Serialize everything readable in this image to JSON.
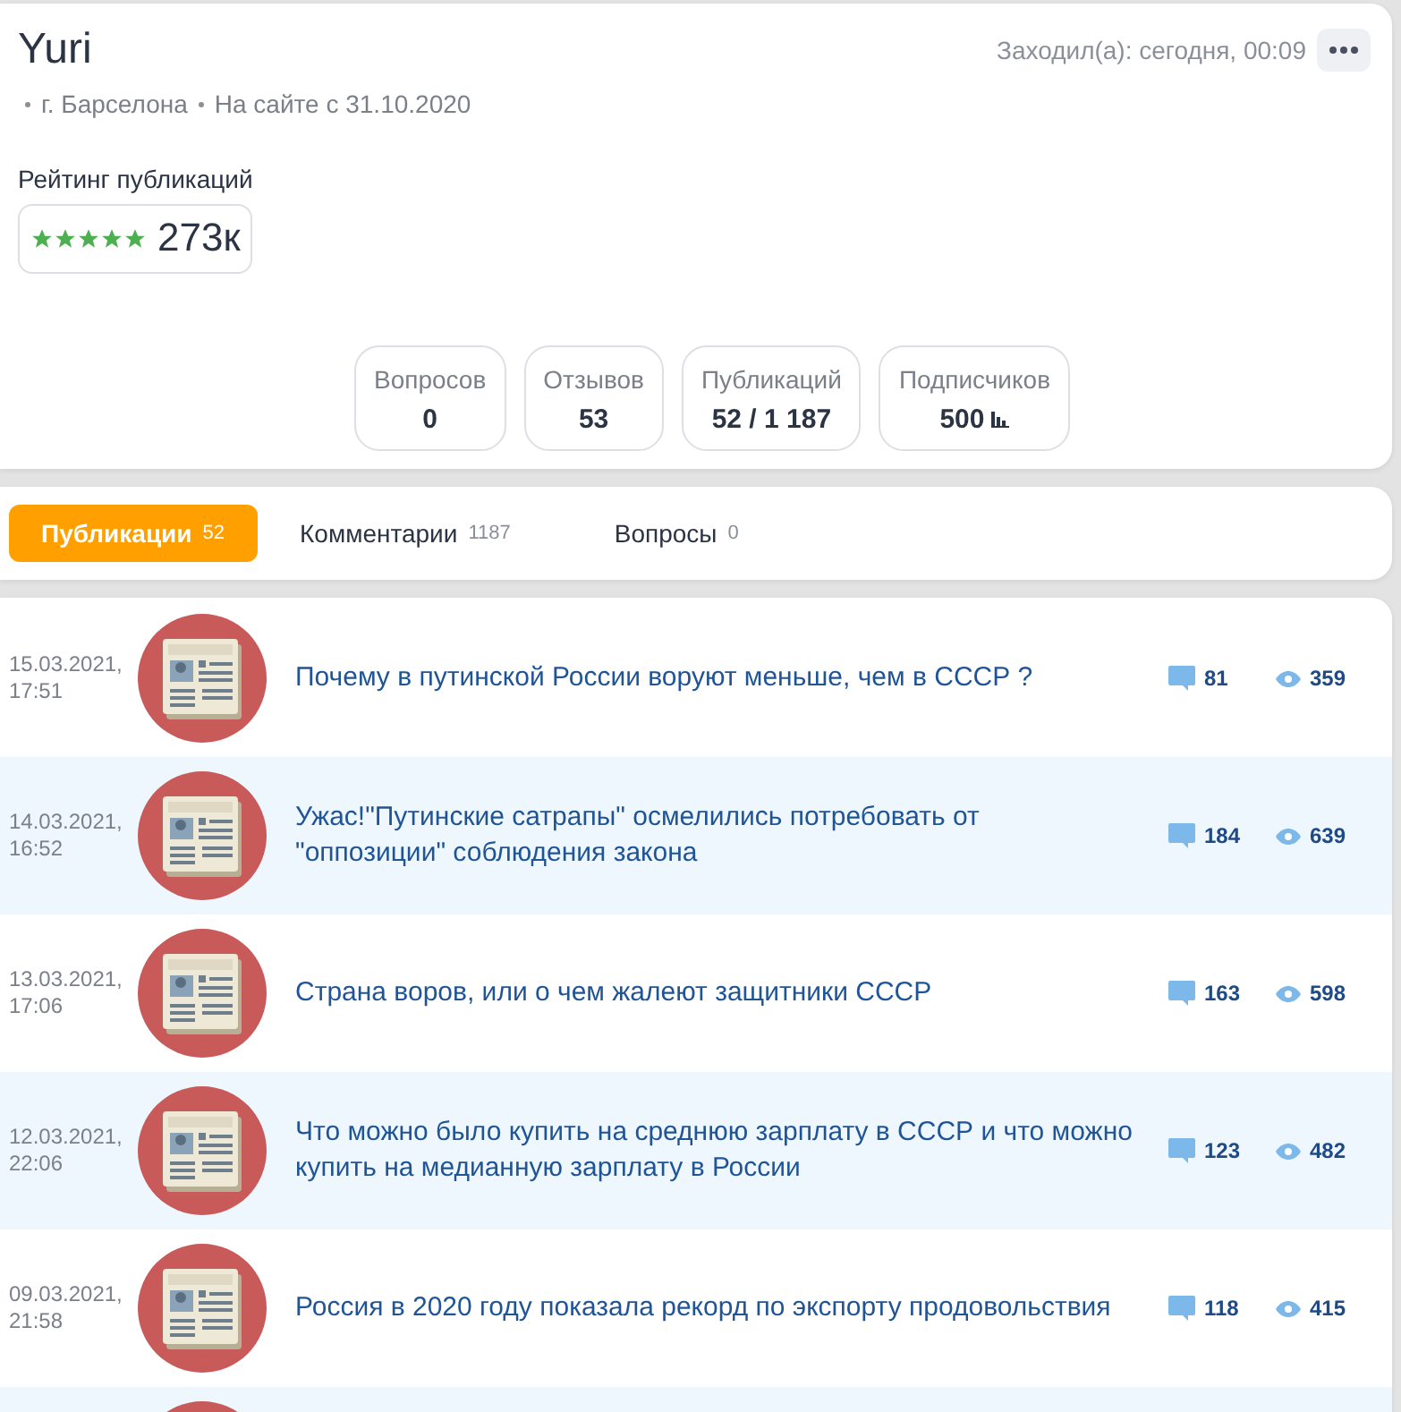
{
  "profile": {
    "name": "Yuri",
    "last_seen": "Заходил(а): сегодня, 00:09",
    "location": "г. Барселона",
    "member_since": "На сайте с 31.10.2020",
    "rating_label": "Рейтинг публикаций",
    "stars": 5,
    "rating_value": "273к",
    "stats": [
      {
        "label": "Вопросов",
        "value": "0",
        "chart_icon": false
      },
      {
        "label": "Отзывов",
        "value": "53",
        "chart_icon": false
      },
      {
        "label": "Публикаций",
        "value": "52 / 1 187",
        "chart_icon": false
      },
      {
        "label": "Подписчиков",
        "value": "500",
        "chart_icon": true
      }
    ]
  },
  "tabs": [
    {
      "label": "Публикации",
      "count": "52",
      "selected": true
    },
    {
      "label": "Комментарии",
      "count": "1187",
      "selected": false
    },
    {
      "label": "Вопросы",
      "count": "0",
      "selected": false
    }
  ],
  "posts": [
    {
      "kind": "full",
      "date": "15.03.2021,",
      "time": "17:51",
      "title": "Почему в путинской России воруют меньше, чем в СССР ?",
      "comments": "81",
      "views": "359"
    },
    {
      "kind": "full",
      "date": "14.03.2021,",
      "time": "16:52",
      "title": "Ужас!\"Путинские сатрапы\" осмелились потребовать от \"оппозиции\" соблюдения закона",
      "comments": "184",
      "views": "639"
    },
    {
      "kind": "full",
      "date": "13.03.2021,",
      "time": "17:06",
      "title": "Страна воров, или о чем жалеют защитники СССР",
      "comments": "163",
      "views": "598"
    },
    {
      "kind": "full",
      "date": "12.03.2021,",
      "time": "22:06",
      "title": "Что можно было купить на среднюю зарплату в СССР и что можно купить на медианную зарплату в России",
      "comments": "123",
      "views": "482"
    },
    {
      "kind": "full",
      "date": "09.03.2021,",
      "time": "21:58",
      "title": "Россия в 2020 году показала рекорд по экспорту продовольствия",
      "comments": "118",
      "views": "415"
    },
    {
      "kind": "partial"
    }
  ]
}
